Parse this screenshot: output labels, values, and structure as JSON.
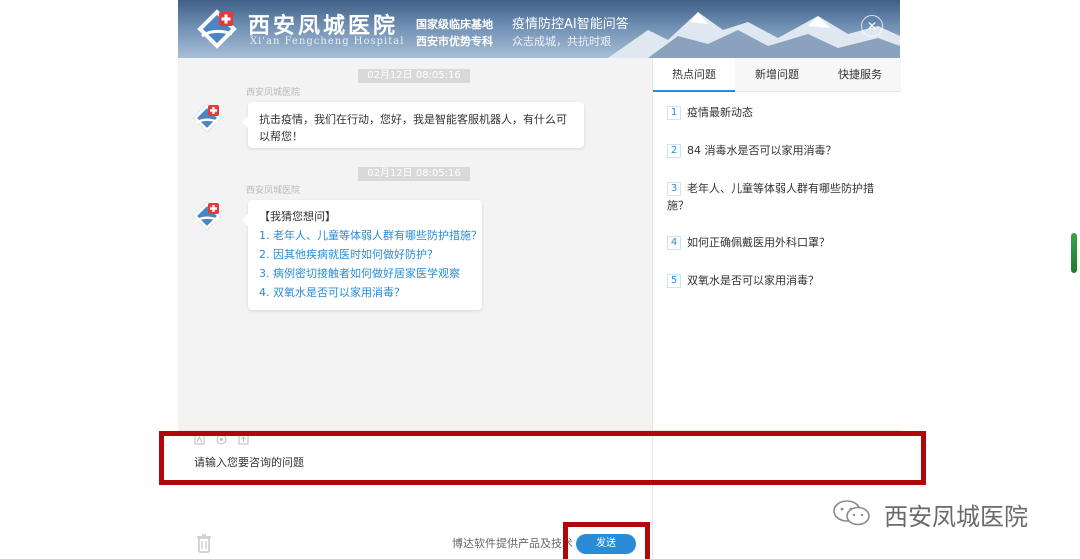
{
  "header": {
    "hospital_name": "西安凤城医院",
    "hospital_name_en": "Xi'an Fengcheng Hospital",
    "base_line1": "国家级临床基地",
    "base_line2": "西安市优势专科",
    "ai_title": "疫情防控AI智能问答",
    "ai_slogan": "众志成城，共抗时艰",
    "close_glyph": "✕"
  },
  "chat": {
    "messages": [
      {
        "time": "02月12日 08:05:16",
        "sender": "西安凤城医院",
        "text": "抗击疫情，我们在行动，您好，我是智能客服机器人，有什么可以帮您！"
      },
      {
        "time": "02月12日 08:05:16",
        "sender": "西安凤城医院",
        "guess_title": "【我猜您想问】",
        "guess_items": [
          "1. 老年人、儿童等体弱人群有哪些防护措施？",
          "2. 因其他疾病就医时如何做好防护？",
          "3. 病例密切接触者如何做好居家医学观察",
          "4. 双氧水是否可以家用消毒？"
        ]
      }
    ]
  },
  "right_panel": {
    "tabs": [
      {
        "label": "热点问题",
        "active": true
      },
      {
        "label": "新增问题",
        "active": false
      },
      {
        "label": "快捷服务",
        "active": false
      }
    ],
    "hot_items": [
      {
        "num": "1",
        "text": "疫情最新动态"
      },
      {
        "num": "2",
        "text": "84 消毒水是否可以家用消毒？"
      },
      {
        "num": "3",
        "text": "老年人、儿童等体弱人群有哪些防护措施？"
      },
      {
        "num": "4",
        "text": "如何正确佩戴医用外科口罩？"
      },
      {
        "num": "5",
        "text": "双氧水是否可以家用消毒？"
      }
    ]
  },
  "input": {
    "placeholder": "请输入您要咨询的问题",
    "powered_by": "博达软件提供产品及技术",
    "send_label": "发送"
  },
  "watermark": {
    "text": "西安凤城医院"
  },
  "colors": {
    "accent": "#2a8cd6",
    "frame": "#b0070b",
    "chat_bg": "#f3f3f3"
  },
  "icons": {
    "avatar": "hospital-logo-icon",
    "close": "close-icon",
    "trash": "trash-icon",
    "wechat": "wechat-icon",
    "toolbar": [
      "font-icon",
      "emoji-icon",
      "upload-icon"
    ]
  }
}
